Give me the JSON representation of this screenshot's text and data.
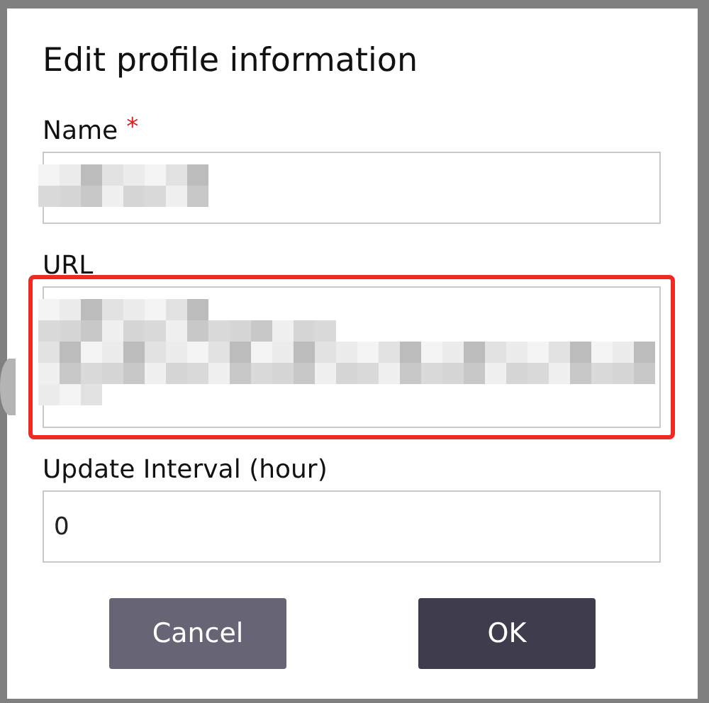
{
  "dialog": {
    "title": "Edit profile information",
    "fields": [
      {
        "label": "Name",
        "required_mark": "*",
        "kind": "input",
        "redacted": true,
        "highlighted": false
      },
      {
        "label": "URL",
        "kind": "textarea",
        "redacted": true,
        "highlighted": true
      },
      {
        "label": "Update Interval (hour)",
        "kind": "input",
        "value": "0",
        "redacted": false,
        "highlighted": false
      }
    ],
    "buttons": [
      {
        "label": "Cancel",
        "kind": "secondary"
      },
      {
        "label": "OK",
        "kind": "primary"
      }
    ]
  }
}
